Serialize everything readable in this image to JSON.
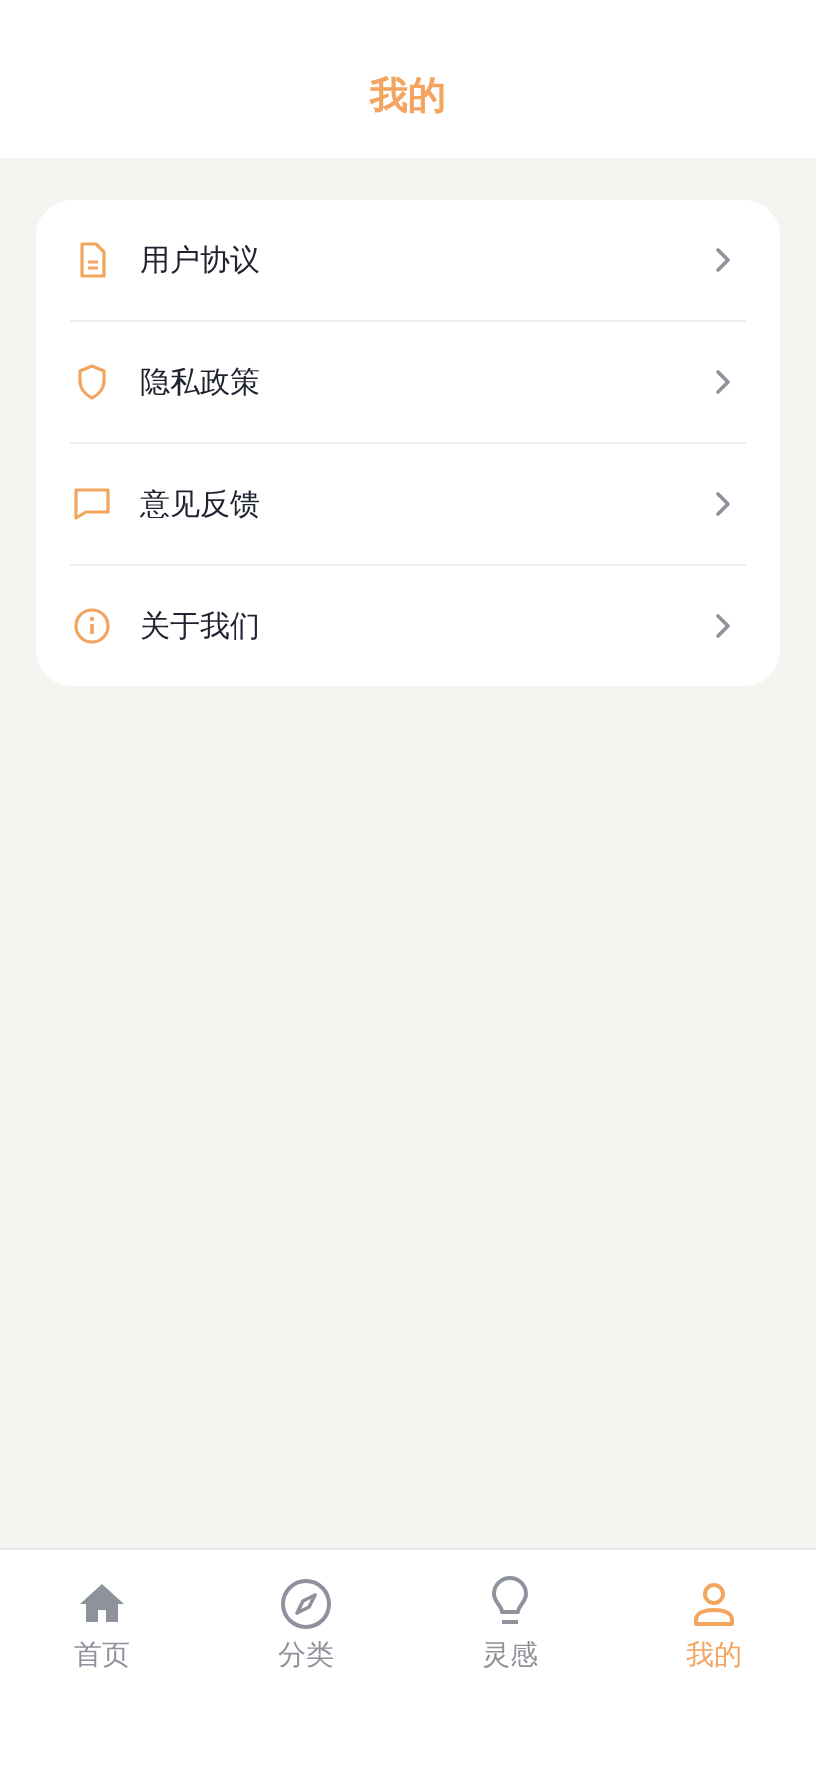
{
  "header": {
    "title": "我的"
  },
  "menu": [
    {
      "kind": "document",
      "label": "用户协议"
    },
    {
      "kind": "shield",
      "label": "隐私政策"
    },
    {
      "kind": "chat",
      "label": "意见反馈"
    },
    {
      "kind": "info",
      "label": "关于我们"
    }
  ],
  "tab_bar": [
    {
      "kind": "home",
      "label": "首页",
      "selected": false
    },
    {
      "kind": "compass",
      "label": "分类",
      "selected": false
    },
    {
      "kind": "bulb",
      "label": "灵感",
      "selected": false
    },
    {
      "kind": "person",
      "label": "我的",
      "selected": true
    }
  ]
}
